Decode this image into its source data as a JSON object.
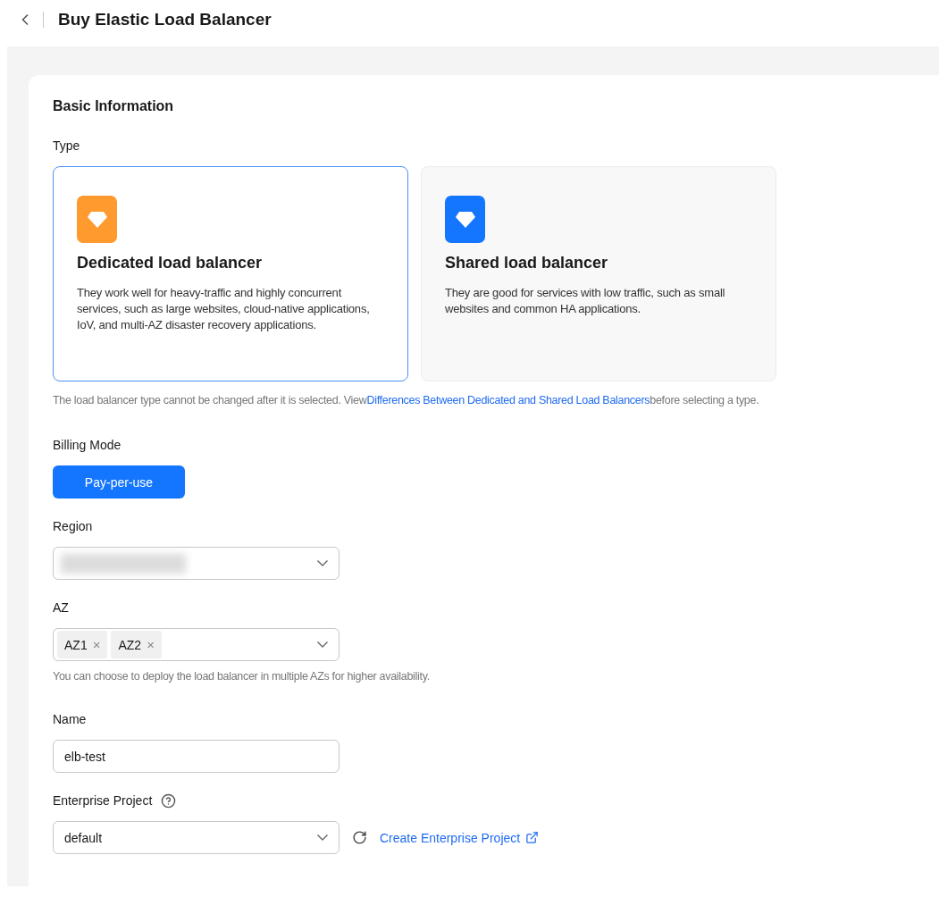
{
  "header": {
    "title": "Buy Elastic Load Balancer"
  },
  "section": {
    "title": "Basic Information"
  },
  "type": {
    "label": "Type",
    "options": [
      {
        "title": "Dedicated load balancer",
        "description": "They work well for heavy-traffic and highly concurrent services, such as large websites, cloud-native applications, IoV, and multi-AZ disaster recovery applications.",
        "color": "#ff9a2e",
        "selected": true
      },
      {
        "title": "Shared load balancer",
        "description": "They are good for services with low traffic, such as small websites and common HA applications.",
        "color": "#1476ff",
        "selected": false
      }
    ],
    "hint": {
      "before": "The load balancer type cannot be changed after it is selected. View",
      "link": "Differences Between Dedicated and Shared Load Balancers",
      "after": "before selecting a type."
    }
  },
  "billing_mode": {
    "label": "Billing Mode",
    "options": [
      {
        "label": "Pay-per-use",
        "selected": true
      }
    ]
  },
  "region": {
    "label": "Region",
    "value_redacted": true
  },
  "az": {
    "label": "AZ",
    "tags": [
      "AZ1",
      "AZ2"
    ],
    "remove_symbol": "×",
    "hint": "You can choose to deploy the load balancer in multiple AZs for higher availability."
  },
  "name": {
    "label": "Name",
    "value": "elb-test"
  },
  "enterprise_project": {
    "label": "Enterprise Project",
    "value": "default",
    "link": "Create Enterprise Project"
  }
}
